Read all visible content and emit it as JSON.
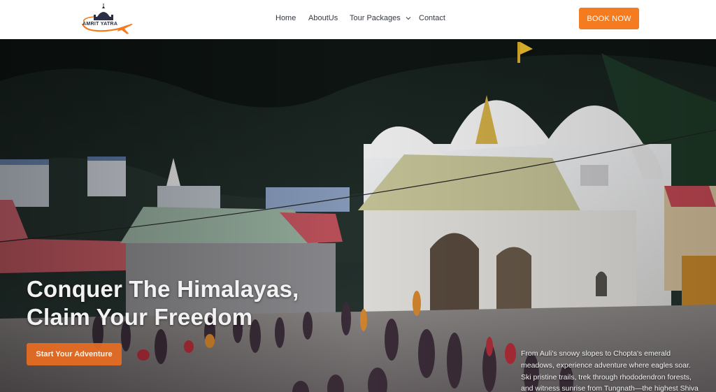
{
  "brand": {
    "name": "AMRIT YATRA",
    "accent": "#f47b20"
  },
  "nav": {
    "items": [
      {
        "label": "Home"
      },
      {
        "label": "AboutUs"
      },
      {
        "label": "Tour Packages",
        "icon": "chevron-down-icon"
      },
      {
        "label": "Contact"
      }
    ],
    "book_label": "BOOK NOW"
  },
  "hero": {
    "headline_line1": "Conquer The Himalayas,",
    "headline_line2": "Claim Your Freedom",
    "cta_label": "Start Your Adventure",
    "description": "From Auli's snowy slopes to Chopta's emerald meadows, experience adventure where eagles soar. Ski pristine trails, trek through rhododendron forests, and witness sunrise from Tungnath—the highest Shiva temple. Your Himalayan journey awaits."
  }
}
